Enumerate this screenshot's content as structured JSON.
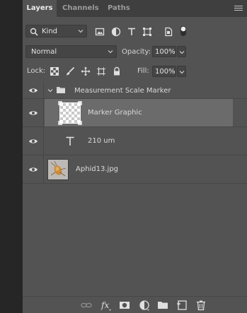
{
  "tabs": [
    {
      "label": "Layers",
      "active": true
    },
    {
      "label": "Channels",
      "active": false
    },
    {
      "label": "Paths",
      "active": false
    }
  ],
  "filter": {
    "kind_label": "Kind",
    "filter_icons": [
      "image-filter-icon",
      "adjustment-filter-icon",
      "type-filter-icon",
      "shape-filter-icon",
      "smart-object-filter-icon",
      "filter-toggle-icon"
    ]
  },
  "blend": {
    "mode": "Normal",
    "opacity_label": "Opacity:",
    "opacity_value": "100%"
  },
  "lock": {
    "label": "Lock:",
    "fill_label": "Fill:",
    "fill_value": "100%",
    "lock_icons": [
      "lock-transparent-icon",
      "lock-image-icon",
      "lock-position-icon",
      "lock-artboard-icon",
      "lock-all-icon"
    ]
  },
  "layers": [
    {
      "name": "Measurement Scale Marker",
      "type": "group",
      "visible": true,
      "expanded": true
    },
    {
      "name": "Marker Graphic",
      "type": "pixel",
      "visible": true,
      "selected": true
    },
    {
      "name": "210 um",
      "type": "text",
      "visible": true
    },
    {
      "name": "Aphid13.jpg",
      "type": "image",
      "visible": true
    }
  ],
  "bottom_toolbar": [
    "link-layers-icon",
    "fx-icon",
    "layer-mask-icon",
    "adjustment-layer-icon",
    "new-group-icon",
    "new-layer-icon",
    "delete-icon"
  ],
  "colors": {
    "panel_bg": "#535353",
    "tab_bar_bg": "#3f3f3f",
    "selected_row": "#6b6b6b",
    "left_strip": "#262626"
  }
}
